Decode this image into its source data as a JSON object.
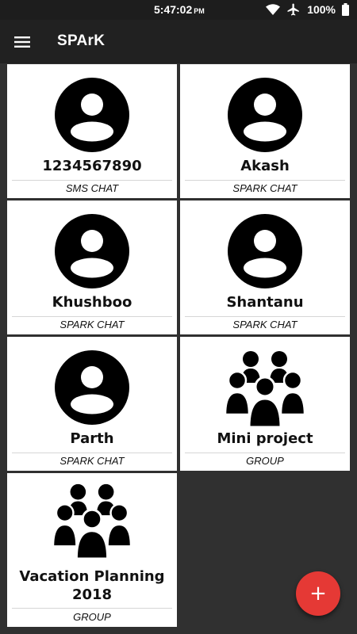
{
  "status_bar": {
    "time": "5:47:02",
    "ampm": "PM",
    "battery": "100%",
    "icons": [
      "wifi-icon",
      "airplane-mode-icon",
      "battery-icon"
    ]
  },
  "app_bar": {
    "title": "SPArK",
    "menu_icon": "hamburger-menu-icon"
  },
  "chats": [
    {
      "name": "1234567890",
      "type": "SMS CHAT",
      "icon": "person-avatar-icon"
    },
    {
      "name": "Akash",
      "type": "SPARK CHAT",
      "icon": "person-avatar-icon"
    },
    {
      "name": "Khushboo",
      "type": "SPARK CHAT",
      "icon": "person-avatar-icon"
    },
    {
      "name": "Shantanu",
      "type": "SPARK CHAT",
      "icon": "person-avatar-icon"
    },
    {
      "name": "Parth",
      "type": "SPARK CHAT",
      "icon": "person-avatar-icon"
    },
    {
      "name": "Mini project",
      "type": "GROUP",
      "icon": "group-people-icon"
    },
    {
      "name": "Vacation Planning 2018",
      "type": "GROUP",
      "icon": "group-people-icon"
    }
  ],
  "fab": {
    "label": "+",
    "icon": "add-icon"
  },
  "colors": {
    "background": "#303030",
    "app_bar": "#212121",
    "status_bar": "#1d1d1d",
    "card": "#ffffff",
    "fab": "#e53935"
  }
}
